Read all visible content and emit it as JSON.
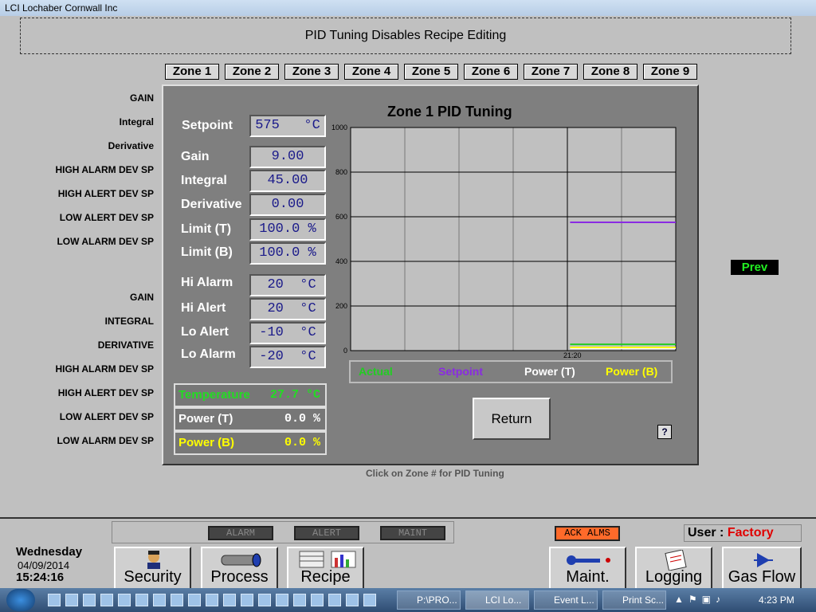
{
  "app": {
    "title": "LCI  Lochaber Cornwall Inc"
  },
  "notice": "PID Tuning Disables Recipe Editing",
  "zone_tabs": [
    "Zone 1",
    "Zone 2",
    "Zone 3",
    "Zone 4",
    "Zone 5",
    "Zone 6",
    "Zone 7",
    "Zone 8",
    "Zone 9"
  ],
  "left_labels_top": [
    "GAIN",
    "Integral",
    "Derivative",
    "HIGH ALARM DEV SP",
    "HIGH ALERT DEV SP",
    "LOW ALERT DEV SP",
    "LOW ALARM DEV SP"
  ],
  "left_labels_bottom": [
    "GAIN",
    "INTEGRAL",
    "DERIVATIVE",
    "HIGH ALARM DEV SP",
    "HIGH ALERT DEV SP",
    "LOW ALERT DEV SP",
    "LOW ALARM DEV SP"
  ],
  "prev_button": "Prev",
  "panel": {
    "title": "Zone 1 PID Tuning",
    "setpoint": {
      "label": "Setpoint",
      "value": "575   °C"
    },
    "tuning": [
      {
        "label": "Gain",
        "value": "9.00"
      },
      {
        "label": "Integral",
        "value": "45.00"
      },
      {
        "label": "Derivative",
        "value": "0.00"
      },
      {
        "label": "Limit (T)",
        "value": "100.0 %"
      },
      {
        "label": "Limit (B)",
        "value": "100.0 %"
      }
    ],
    "alarms": [
      {
        "label": "Hi Alarm",
        "value": " 20  °C"
      },
      {
        "label": "Hi Alert",
        "value": " 20  °C"
      },
      {
        "label": "Lo Alert",
        "value": "-10  °C"
      },
      {
        "label": "Lo Alarm",
        "value": "-20  °C"
      }
    ],
    "status": [
      {
        "label": "Temperature",
        "value": "27.7 °C",
        "color": "#22dd22"
      },
      {
        "label": "Power (T)",
        "value": "0.0 %",
        "color": "#ffffff"
      },
      {
        "label": "Power (B)",
        "value": "0.0 %",
        "color": "#ffff00"
      }
    ],
    "return_button": "Return",
    "help_icon": "help-icon",
    "footer": "Click on Zone # for PID Tuning"
  },
  "chart_data": {
    "type": "line",
    "ylim": [
      0,
      1000
    ],
    "y_ticks": [
      "0",
      "200",
      "400",
      "600",
      "800",
      "1000"
    ],
    "x_tick_label": "21:20",
    "x_range": [
      0,
      1
    ],
    "series": [
      {
        "name": "Actual",
        "color": "#22cc22",
        "x": [
          0.675,
          1.0
        ],
        "values": [
          28,
          28
        ]
      },
      {
        "name": "Setpoint",
        "color": "#8a2be2",
        "x": [
          0.675,
          1.0
        ],
        "values": [
          575,
          575
        ]
      },
      {
        "name": "Power (T)",
        "color": "#ffffff",
        "x": [
          0.675,
          1.0
        ],
        "values": [
          0,
          0
        ]
      },
      {
        "name": "Power (B)",
        "color": "#ffff00",
        "x": [
          0.675,
          1.0
        ],
        "values": [
          0,
          0
        ]
      }
    ]
  },
  "status_bar": {
    "indicators": [
      "ALARM",
      "ALERT",
      "MAINT"
    ],
    "ack_button": "ACK ALMS",
    "user_label": "User :",
    "user_value": "Factory"
  },
  "datetime": {
    "day": "Wednesday",
    "date": "04/09/2014",
    "time": "15:24:16"
  },
  "bottom_buttons": [
    "Security",
    "Process",
    "Recipe",
    "Maint.",
    "Logging",
    "Gas Flow"
  ],
  "taskbar": {
    "tasks": [
      "P:\\PRO...",
      "LCI Lo...",
      "Event L...",
      "Print Sc..."
    ],
    "clock": "4:23 PM"
  }
}
